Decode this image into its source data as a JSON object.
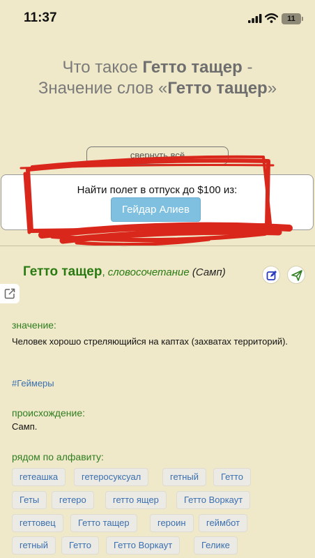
{
  "status_bar": {
    "time": "11:37",
    "battery": "11"
  },
  "page_title": {
    "line1_prefix": "Что такое ",
    "line1_bold": "Гетто тащер",
    "line1_suffix": " -",
    "line2_prefix": "Значение слов «",
    "line2_bold": "Гетто тащер",
    "line2_suffix": "»"
  },
  "expand_button": "свернуть всё",
  "ad": {
    "text": "Найти полет в отпуск до $100 из:",
    "button": "Гейдар Алиев"
  },
  "entry": {
    "headword": "Гетто тащер",
    "comma": ", ",
    "part_of_speech": "словосочетание",
    "region": " (Самп)",
    "meaning_label": "значение:",
    "meaning_text": "Человек хорошо стреляющийся на каптах (захватах территорий).",
    "hashtag": "#Геймеры",
    "origin_label": "происхождение:",
    "origin_text": "Самп.",
    "nearby_label": "рядом по алфавиту:"
  },
  "nearby_words": [
    "гетеашка",
    "гетеросуксуал",
    "гетный",
    "Гетто",
    "Геты",
    "гетеро",
    "гетто ящер",
    "Гетто Воркаут",
    "геттовец",
    "Гетто тащер",
    "героин",
    "геймбот",
    "гетный",
    "Гетто",
    "Гетто Воркаут",
    "Гелике"
  ],
  "colors": {
    "background": "#efe9c9",
    "green": "#2a7a12",
    "link": "#3a6fb0",
    "scribble": "#d9271c"
  },
  "icons": [
    "signal-icon",
    "wifi-icon",
    "edit-icon",
    "send-icon",
    "external-link-icon"
  ]
}
